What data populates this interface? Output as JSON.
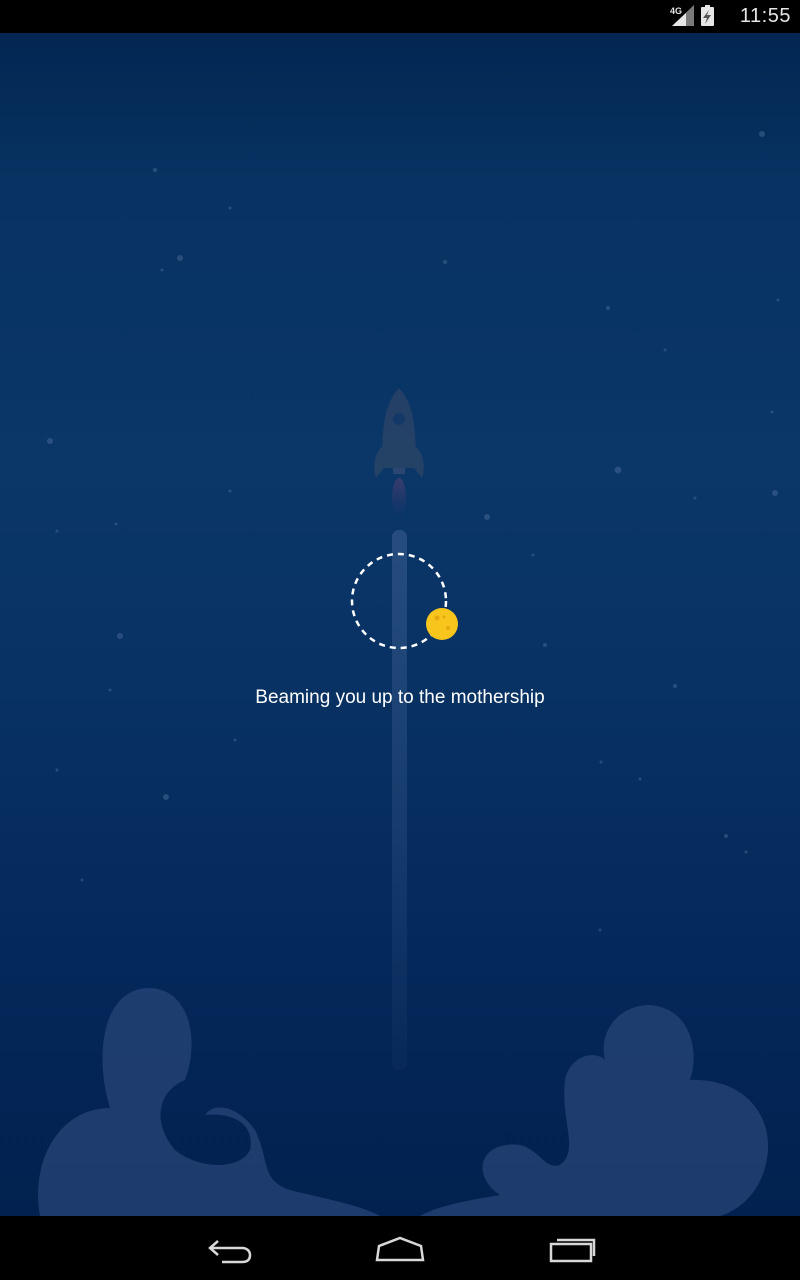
{
  "status_bar": {
    "time": "11:55",
    "network_type": "4G",
    "icons": [
      "signal-icon",
      "battery-charging-icon"
    ]
  },
  "loading": {
    "message": "Beaming you up to the mothership"
  },
  "colors": {
    "background_top": "#032652",
    "background_bottom": "#02214f",
    "smoke_cloud": "#2d4a7c",
    "spinner_dot": "#f7c51c",
    "text": "#ffffff"
  },
  "nav_bar": {
    "buttons": [
      "back-icon",
      "home-icon",
      "recent-apps-icon"
    ]
  }
}
